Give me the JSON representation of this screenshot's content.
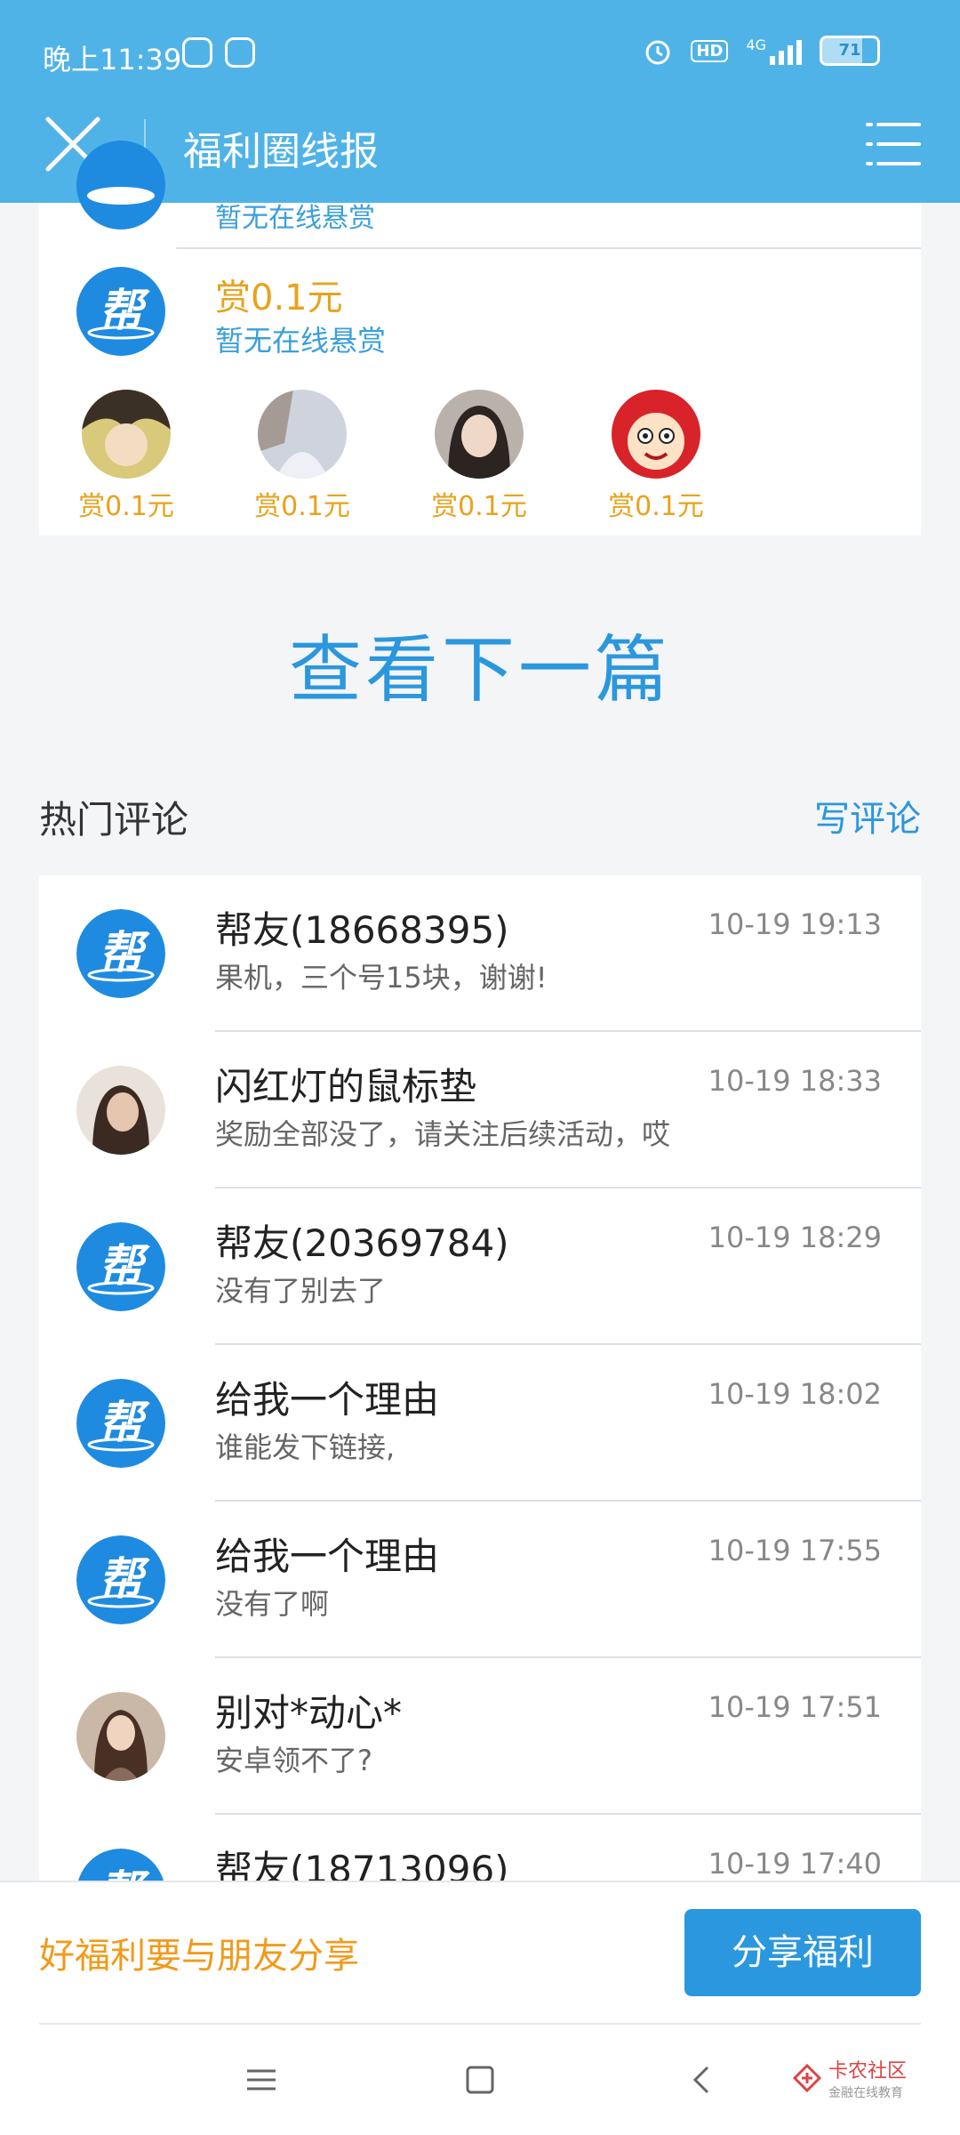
{
  "status_bar": {
    "time": "晚上11:39",
    "network": "4G",
    "hd": "HD",
    "battery": "71"
  },
  "header": {
    "title": "福利圈线报"
  },
  "reward_card": {
    "partial_sub": "暂无在线悬赏",
    "amount": "赏0.1元",
    "sub": "暂无在线悬赏",
    "avatars": [
      {
        "label": "赏0.1元"
      },
      {
        "label": "赏0.1元"
      },
      {
        "label": "赏0.1元"
      },
      {
        "label": "赏0.1元"
      }
    ]
  },
  "next_article": "查看下一篇",
  "comments_section": {
    "title": "热门评论",
    "write_label": "写评论"
  },
  "comments": [
    {
      "name": "帮友(18668395)",
      "time": "10-19 19:13",
      "text": "果机，三个号15块，谢谢!",
      "avatar": "bang-logo"
    },
    {
      "name": "闪红灯的鼠标垫",
      "time": "10-19 18:33",
      "text": "奖励全部没了，请关注后续活动，哎",
      "avatar": "user-photo"
    },
    {
      "name": "帮友(20369784)",
      "time": "10-19 18:29",
      "text": "没有了别去了",
      "avatar": "bang-logo"
    },
    {
      "name": "给我一个理由",
      "time": "10-19 18:02",
      "text": "谁能发下链接,",
      "avatar": "bang-logo"
    },
    {
      "name": "给我一个理由",
      "time": "10-19 17:55",
      "text": "没有了啊",
      "avatar": "bang-logo"
    },
    {
      "name": "别对*动心*",
      "time": "10-19 17:51",
      "text": "安卓领不了?",
      "avatar": "user-photo"
    },
    {
      "name": "帮友(18713096)",
      "time": "10-19 17:40",
      "text": "",
      "avatar": "bang-logo"
    }
  ],
  "share_bar": {
    "text": "好福利要与朋友分享",
    "button": "分享福利"
  },
  "watermark": {
    "main": "卡农社区",
    "sub": "金融在线教育"
  },
  "colors": {
    "header": "#4fb3e8",
    "accent_blue": "#2b97de",
    "orange": "#e9a21b"
  }
}
